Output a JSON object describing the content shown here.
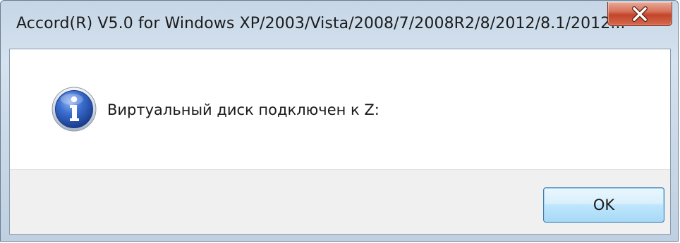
{
  "window": {
    "title": "Accord(R) V5.0 for Windows XP/2003/Vista/2008/7/2008R2/8/2012/8.1/2012...",
    "close_icon": "close-x-icon"
  },
  "message": {
    "icon": "information-icon",
    "text": "Виртуальный диск подключен к Z:"
  },
  "buttons": {
    "ok_label": "OK"
  },
  "colors": {
    "title_bar": "#c6d6e6",
    "close_button": "#c2452b",
    "ok_button_border": "#3c7fb1",
    "info_icon": "#2453b8"
  }
}
